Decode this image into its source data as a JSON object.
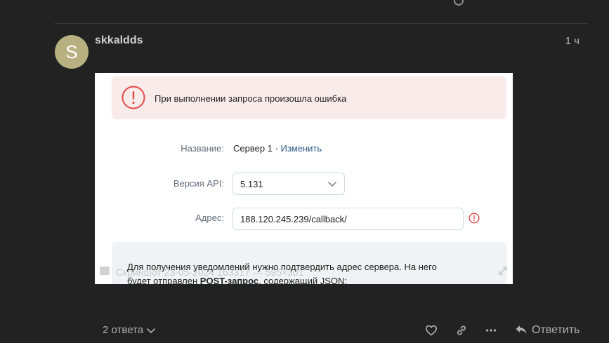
{
  "post": {
    "avatar_letter": "S",
    "username": "skkaldds",
    "time": "1 ч"
  },
  "screenshot": {
    "error_text": "При выполнении запроса произошла ошибка",
    "name_label": "Название:",
    "name_value": "Сервер 1 · ",
    "name_edit_link": "Изменить",
    "api_label": "Версия API:",
    "api_value": "5.131",
    "address_label": "Адрес:",
    "address_value": "188.120.245.239/callback/",
    "info_line1": "Для получения уведомлений нужно подтвердить адрес сервера. На него",
    "info_line2_start": "будет отправлен ",
    "info_line2_bold": "POST-запрос",
    "info_line2_end": ", содержащий JSON:",
    "caption": "Скриншот 23-05-2024 163317 — 595×301"
  },
  "footer": {
    "replies_label": "2 ответа",
    "reply_label": "Ответить"
  },
  "colors": {
    "page_bg": "#222222",
    "avatar_bg": "#b9b081",
    "error_bg": "#faebeb",
    "error_icon": "#e64646",
    "link": "#2a5885"
  }
}
